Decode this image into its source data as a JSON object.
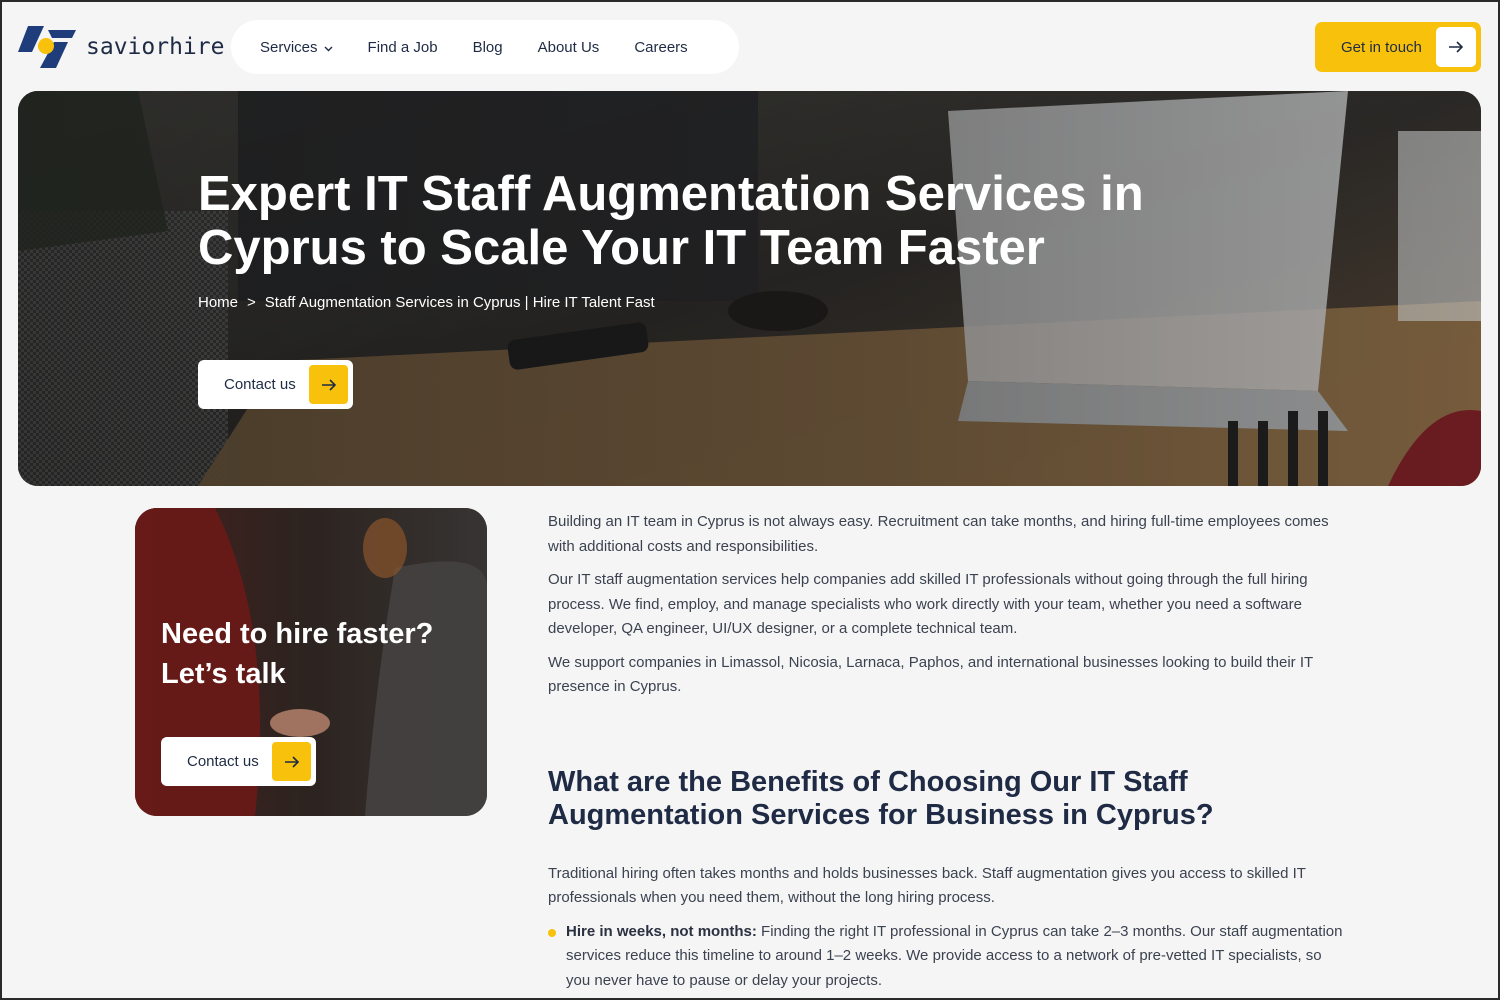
{
  "logo": {
    "text": "saviorhire",
    "icon": "saviorhire-logo-icon"
  },
  "nav": {
    "items": [
      {
        "label": "Services",
        "has_dropdown": true
      },
      {
        "label": "Find a Job"
      },
      {
        "label": "Blog"
      },
      {
        "label": "About Us"
      },
      {
        "label": "Careers"
      }
    ]
  },
  "header_cta": {
    "label": "Get in touch",
    "icon": "arrow-right-icon"
  },
  "hero": {
    "title": "Expert IT Staff Augmentation Services in Cyprus to Scale Your IT Team Faster",
    "breadcrumb": {
      "home": "Home",
      "separator": ">",
      "current": "Staff Augmentation Services in Cyprus | Hire IT Talent Fast"
    },
    "button_label": "Contact us"
  },
  "card": {
    "title": "Need to hire faster? Let’s talk",
    "button_label": "Contact us"
  },
  "content": {
    "paragraphs": [
      "Building an IT team in Cyprus is not always easy. Recruitment can take months, and hiring full-time employees comes with additional costs and responsibilities.",
      "Our IT staff augmentation services help companies add skilled IT professionals without going through the full hiring process. We find, employ, and manage specialists who work directly with your team, whether you need a software developer, QA engineer, UI/UX designer, or a complete technical team.",
      "We support companies in Limassol, Nicosia, Larnaca, Paphos, and international businesses looking to build their IT presence in Cyprus."
    ],
    "heading": "What are the Benefits of Choosing Our IT Staff Augmentation Services for Business in Cyprus?",
    "intro": "Traditional hiring often takes months and holds businesses back. Staff augmentation gives you access to skilled IT professionals when you need them, without the long hiring process.",
    "bullets": [
      {
        "strong": "Hire in weeks, not months:",
        "text": " Finding the right IT professional in Cyprus can take 2–3 months. Our staff augmentation services reduce this timeline to around 1–2 weeks. We provide access to a network of pre-vetted IT specialists, so you never have to pause or delay your projects."
      }
    ]
  },
  "colors": {
    "accent": "#f8c20c",
    "brand_navy": "#1f2b44",
    "background": "#f5f5f5"
  }
}
